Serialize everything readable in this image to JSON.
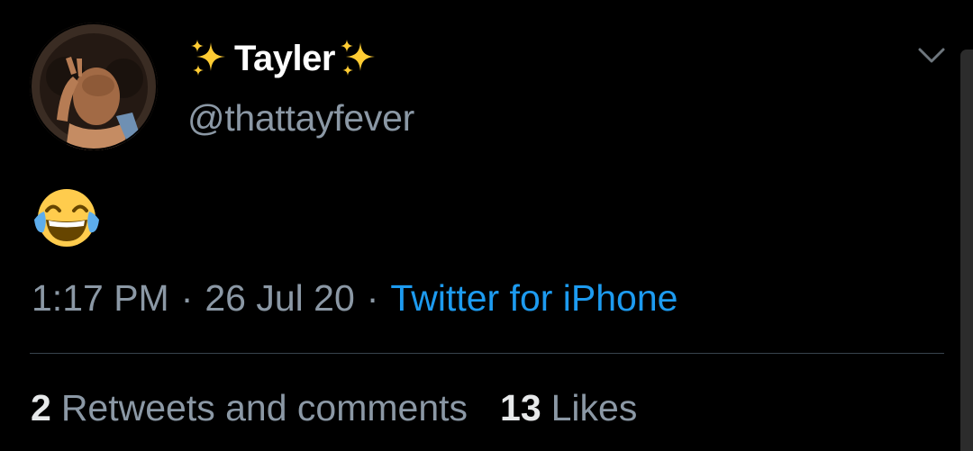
{
  "user": {
    "display_name": "Tayler",
    "name_decoration_icon": "sparkles-icon",
    "handle": "@thattayfever"
  },
  "tweet": {
    "content_emoji": "face-with-tears-of-joy"
  },
  "meta": {
    "time": "1:17 PM",
    "separator": "·",
    "date": "26 Jul 20",
    "source": "Twitter for iPhone"
  },
  "stats": {
    "retweets_count": "2",
    "retweets_label": "Retweets and comments",
    "likes_count": "13",
    "likes_label": "Likes"
  },
  "colors": {
    "background": "#000000",
    "text_primary": "#ffffff",
    "text_secondary": "#8b98a5",
    "link": "#1d9bf0",
    "divider": "#38444d"
  }
}
